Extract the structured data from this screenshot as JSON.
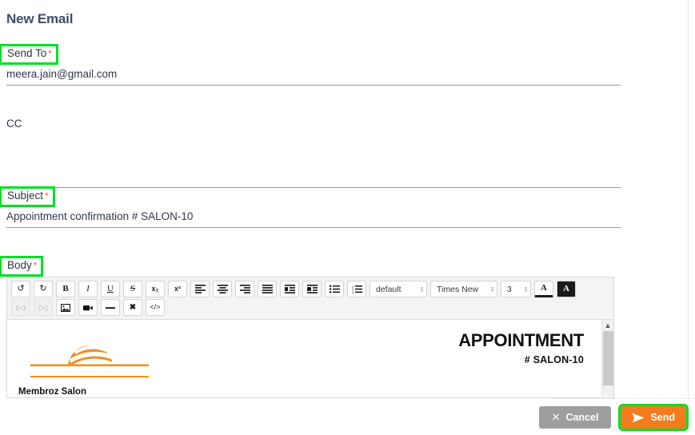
{
  "page": {
    "title": "New Email"
  },
  "fields": {
    "send_to": {
      "label": "Send To",
      "required_marker": "*",
      "value": "meera.jain@gmail.com",
      "placeholder": ""
    },
    "cc": {
      "label": "CC",
      "value": "",
      "placeholder": ""
    },
    "subject": {
      "label": "Subject",
      "required_marker": "*",
      "value": "Appointment confirmation # SALON-10",
      "placeholder": ""
    },
    "body": {
      "label": "Body",
      "required_marker": "*"
    }
  },
  "editor": {
    "toolbar_row1": [
      {
        "name": "undo-icon",
        "glyph": "↺",
        "title": "Undo",
        "disabled": false
      },
      {
        "name": "redo-icon",
        "glyph": "↻",
        "title": "Redo",
        "disabled": false
      },
      {
        "name": "bold-icon",
        "glyph": "B",
        "title": "Bold",
        "disabled": false
      },
      {
        "name": "italic-icon",
        "glyph": "I",
        "title": "Italic",
        "disabled": false
      },
      {
        "name": "underline-icon",
        "glyph": "U",
        "title": "Underline",
        "disabled": false
      },
      {
        "name": "strikethrough-icon",
        "glyph": "S",
        "title": "Strikethrough",
        "disabled": false
      },
      {
        "name": "subscript-icon",
        "glyph": "x₂",
        "title": "Subscript",
        "disabled": false
      },
      {
        "name": "superscript-icon",
        "glyph": "x²",
        "title": "Superscript",
        "disabled": false
      }
    ],
    "align_buttons": [
      {
        "name": "align-left-icon",
        "title": "Align left"
      },
      {
        "name": "align-center-icon",
        "title": "Align center"
      },
      {
        "name": "align-right-icon",
        "title": "Align right"
      },
      {
        "name": "align-justify-icon",
        "title": "Justify"
      },
      {
        "name": "outdent-icon",
        "title": "Outdent"
      },
      {
        "name": "indent-icon",
        "title": "Indent"
      },
      {
        "name": "unordered-list-icon",
        "title": "Bulleted list"
      },
      {
        "name": "ordered-list-icon",
        "title": "Numbered list"
      }
    ],
    "selects": {
      "style": "default",
      "font": "Times New",
      "size": "3",
      "caret": "↕"
    },
    "color_buttons": [
      {
        "name": "font-color-icon",
        "glyph": "A",
        "title": "Font color"
      },
      {
        "name": "highlight-color-icon",
        "glyph": "A",
        "title": "Highlight color"
      }
    ],
    "toolbar_row2": [
      {
        "name": "link-icon",
        "glyph": "🔗",
        "title": "Insert link",
        "disabled": true
      },
      {
        "name": "unlink-icon",
        "glyph": "🔗",
        "title": "Remove link",
        "disabled": true
      },
      {
        "name": "image-icon",
        "glyph": "🏞",
        "title": "Insert image",
        "disabled": false
      },
      {
        "name": "video-icon",
        "glyph": "▶",
        "title": "Insert video",
        "disabled": false
      },
      {
        "name": "horizontal-rule-icon",
        "glyph": "—",
        "title": "Horizontal rule",
        "disabled": false
      },
      {
        "name": "clear-format-icon",
        "glyph": "✖",
        "title": "Clear formatting",
        "disabled": false
      },
      {
        "name": "code-view-icon",
        "glyph": "</>",
        "title": "Code view",
        "disabled": false
      }
    ],
    "content": {
      "heading": "APPOINTMENT",
      "reference": "# SALON-10",
      "company": "Membroz Salon",
      "logo_name": "membroz-salon-logo"
    },
    "scrollbar": {
      "up_arrow": "▲"
    }
  },
  "footer": {
    "cancel_label": "Cancel",
    "cancel_icon": "✕",
    "send_label": "Send",
    "send_icon": "send-plane-icon"
  },
  "colors": {
    "accent_orange": "#f57b1f",
    "highlight_green": "#00e023",
    "required_red": "#ff5252",
    "title_navy": "#3f4d67",
    "cancel_gray": "#9e9e9e"
  }
}
